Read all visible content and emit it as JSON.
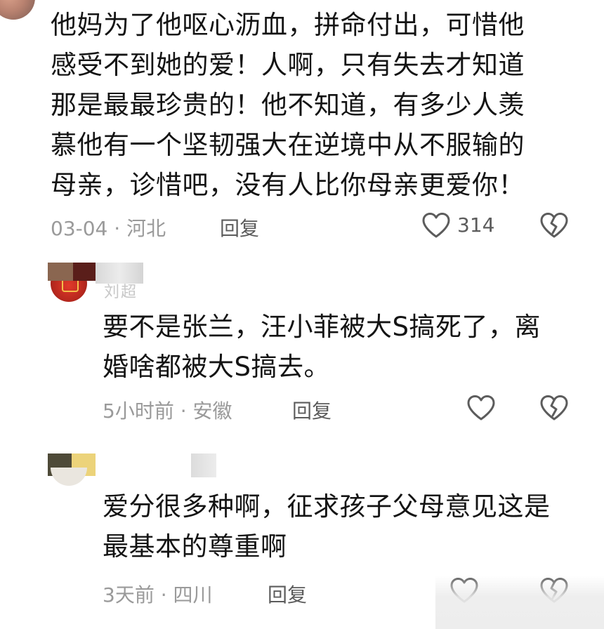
{
  "comments": [
    {
      "text": "他妈为了他呕心沥血，拼命付出，可惜他\n感受不到她的爱！人啊，只有失去才知道\n那是最最珍贵的！他不知道，有多少人羡\n慕他有一个坚韧强大在逆境中从不服输的\n母亲，诊惜吧，没有人比你母亲更爱你！",
      "date_location": "03-04 · 河北",
      "reply_label": "回复",
      "like_count": "314"
    },
    {
      "author_partial": "刘超",
      "text": "要不是张兰，汪小菲被大S搞死了，离\n婚啥都被大S搞去。",
      "date_location": "5小时前 · 安徽",
      "reply_label": "回复",
      "like_count": ""
    },
    {
      "text": "爱分很多种啊，征求孩子父母意见这是\n最基本的尊重啊",
      "date_location": "3天前 · 四川",
      "reply_label": "回复",
      "like_count": ""
    }
  ],
  "icons": {
    "like": "heart-outline-icon",
    "dislike": "broken-heart-icon"
  },
  "colors": {
    "text": "#141414",
    "meta": "#9a9a9a",
    "icon": "#5c5c5c"
  }
}
